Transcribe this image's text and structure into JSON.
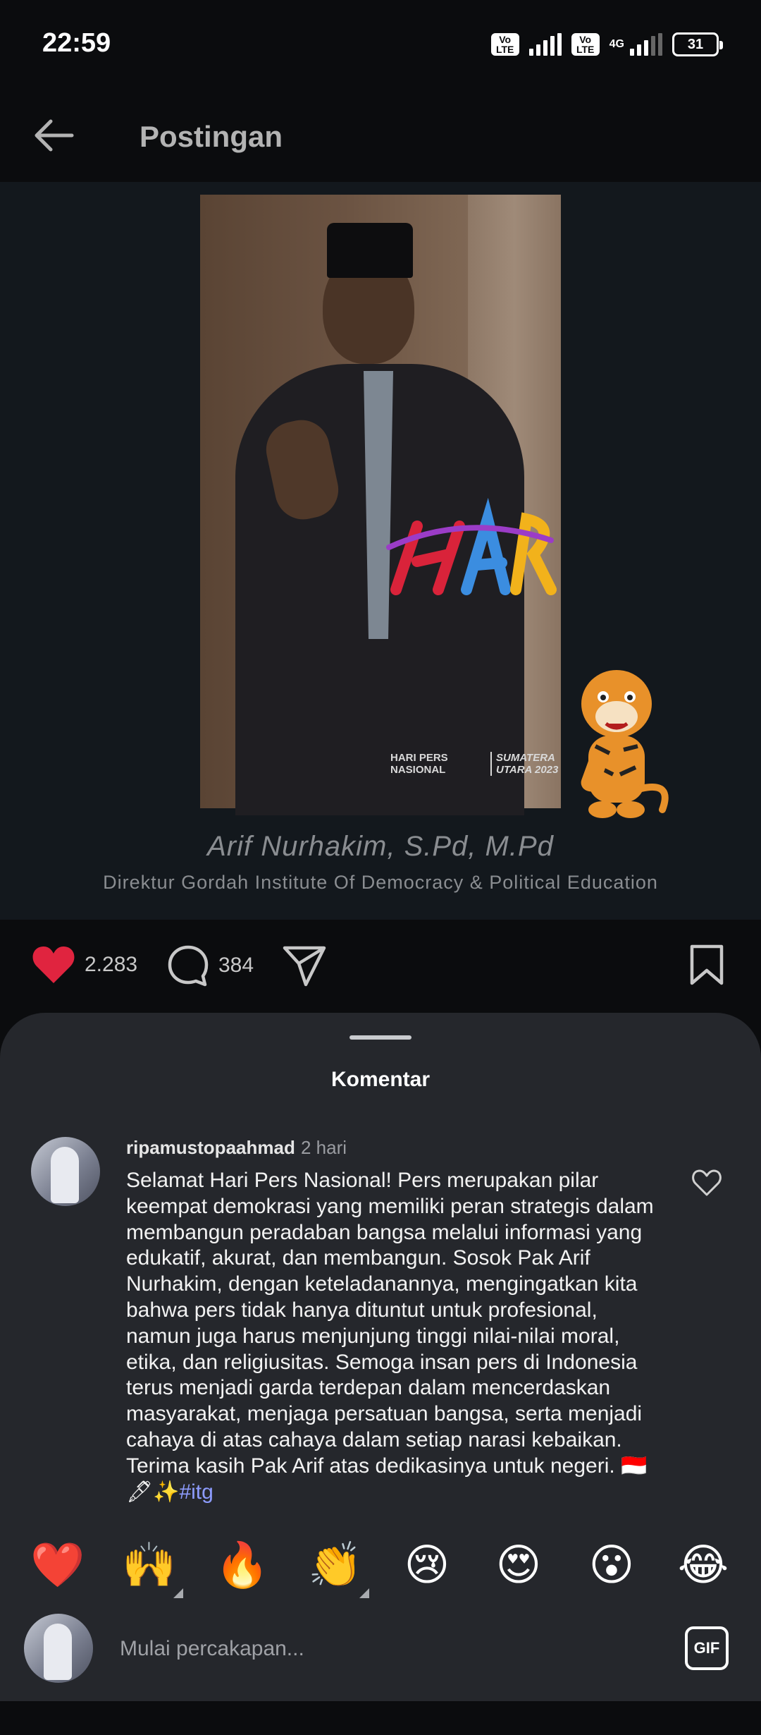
{
  "status_bar": {
    "time": "22:59",
    "volte1": "Vo LTE",
    "volte2": "Vo LTE",
    "network": "4G",
    "battery": "31"
  },
  "header": {
    "title": "Postingan",
    "back_icon": "arrow-left-icon"
  },
  "post": {
    "image_caption_name": "Arif Nurhakim, S.Pd, M.Pd",
    "image_caption_title": "Direktur Gordah Institute Of Democracy & Political Education",
    "logo_left": "HARI PERS\nNASIONAL",
    "logo_right": "SUMATERA\nUTARA 2023"
  },
  "actions": {
    "likes": "2.283",
    "comments": "384",
    "like_icon": "heart-filled-icon",
    "comment_icon": "comment-bubble-icon",
    "share_icon": "paper-plane-icon",
    "save_icon": "bookmark-icon",
    "like_color": "#e0243f"
  },
  "comments_sheet": {
    "title": "Komentar",
    "comment": {
      "username": "ripamustopaahmad",
      "time": "2 hari",
      "text": "Selamat Hari Pers Nasional! Pers merupakan pilar keempat demokrasi yang memiliki peran strategis dalam membangun peradaban bangsa melalui informasi yang edukatif, akurat, dan membangun. Sosok Pak Arif Nurhakim, dengan keteladanannya, mengingatkan kita bahwa pers tidak hanya dituntut untuk profesional, namun juga harus menjunjung tinggi nilai-nilai moral, etika, dan religiusitas. Semoga insan pers di Indonesia terus menjadi garda terdepan dalam mencerdaskan masyarakat, menjaga persatuan bangsa, serta menjadi cahaya di atas cahaya dalam setiap narasi kebaikan. Terima kasih Pak Arif atas dedikasinya untuk negeri. 🇮🇩🖋✨",
      "hashtag": "#itg"
    },
    "emojis": [
      "❤️",
      "🙌",
      "🔥",
      "👏",
      "😢",
      "😍",
      "😮",
      "😂"
    ],
    "composer_placeholder": "Mulai percakapan...",
    "gif_label": "GIF"
  }
}
